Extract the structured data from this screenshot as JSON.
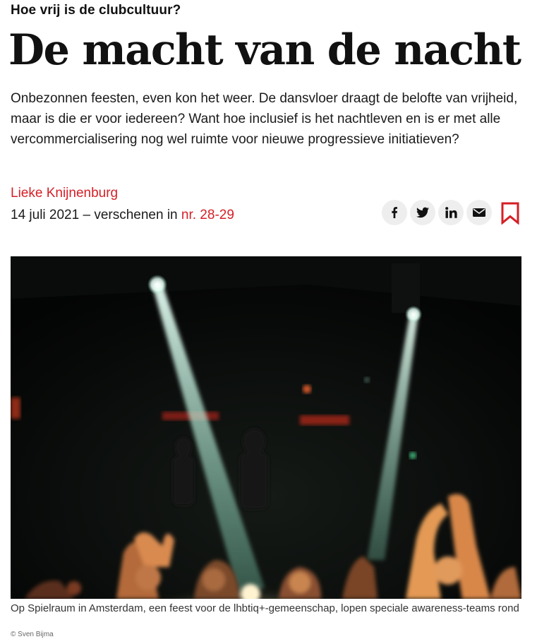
{
  "article": {
    "kicker": "Hoe vrij is de clubcultuur?",
    "headline": "De macht van de nacht",
    "intro": "Onbezonnen feesten, even kon het weer. De dansvloer draagt de belofte van vrijheid, maar is die er voor iedereen? Want hoe inclusief is het nachtleven en is er met alle vercommercialisering nog wel ruimte voor nieuwe progressieve initiatieven?",
    "author": "Lieke Knijnenburg",
    "date": "14 juli 2021",
    "published_in_prefix": " – verschenen in ",
    "issue": "nr. 28-29"
  },
  "share": {
    "buttons": [
      {
        "name": "facebook",
        "icon": "facebook-icon"
      },
      {
        "name": "twitter",
        "icon": "twitter-icon"
      },
      {
        "name": "linkedin",
        "icon": "linkedin-icon"
      },
      {
        "name": "email",
        "icon": "mail-icon"
      }
    ],
    "bookmark_icon": "bookmark-icon"
  },
  "figure": {
    "caption": "Op Spielraum in Amsterdam, een feest voor de lhbtiq+-gemeenschap, lopen speciale awareness-teams rond",
    "credit": "© Sven Bijma"
  },
  "colors": {
    "accent": "#d51f26",
    "text": "#111111",
    "share_bg": "#eeeeee",
    "photo_dark": "#050707",
    "light_beam": "#d9f5ec",
    "crowd_skin": "#e08a4a"
  }
}
